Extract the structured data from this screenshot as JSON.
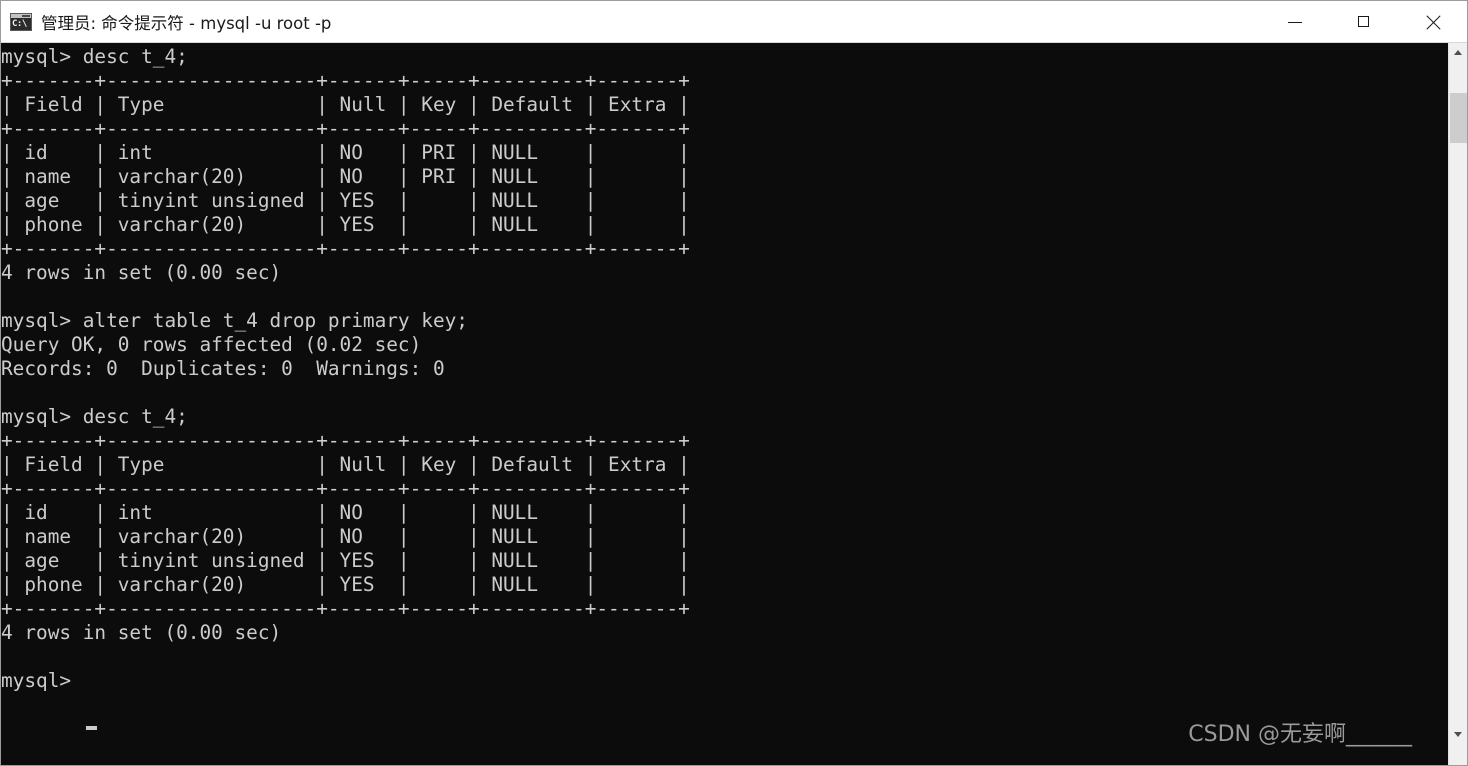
{
  "window": {
    "title": "管理员: 命令提示符 - mysql  -u root -p",
    "icon": "cmd-console-icon",
    "icon_text": "C:\\",
    "background": "#0c0c0c",
    "foreground": "#cccccc",
    "titlebar_background": "#ffffff"
  },
  "controls": {
    "minimize_label": "—",
    "maximize_label": "□",
    "close_label": "✕"
  },
  "terminal": {
    "prompt": "mysql>",
    "cursor": "_",
    "lines": [
      "mysql> desc t_4;",
      "+-------+------------------+------+-----+---------+-------+",
      "| Field | Type             | Null | Key | Default | Extra |",
      "+-------+------------------+------+-----+---------+-------+",
      "| id    | int              | NO   | PRI | NULL    |       |",
      "| name  | varchar(20)      | NO   | PRI | NULL    |       |",
      "| age   | tinyint unsigned | YES  |     | NULL    |       |",
      "| phone | varchar(20)      | YES  |     | NULL    |       |",
      "+-------+------------------+------+-----+---------+-------+",
      "4 rows in set (0.00 sec)",
      "",
      "mysql> alter table t_4 drop primary key;",
      "Query OK, 0 rows affected (0.02 sec)",
      "Records: 0  Duplicates: 0  Warnings: 0",
      "",
      "mysql> desc t_4;",
      "+-------+------------------+------+-----+---------+-------+",
      "| Field | Type             | Null | Key | Default | Extra |",
      "+-------+------------------+------+-----+---------+-------+",
      "| id    | int              | NO   |     | NULL    |       |",
      "| name  | varchar(20)      | NO   |     | NULL    |       |",
      "| age   | tinyint unsigned | YES  |     | NULL    |       |",
      "| phone | varchar(20)      | YES  |     | NULL    |       |",
      "+-------+------------------+------+-----+---------+-------+",
      "4 rows in set (0.00 sec)",
      "",
      "mysql> "
    ],
    "commands": [
      "desc t_4;",
      "alter table t_4 drop primary key;",
      "desc t_4;"
    ],
    "results": {
      "first_desc": {
        "columns": [
          "Field",
          "Type",
          "Null",
          "Key",
          "Default",
          "Extra"
        ],
        "rows": [
          [
            "id",
            "int",
            "NO",
            "PRI",
            "NULL",
            ""
          ],
          [
            "name",
            "varchar(20)",
            "NO",
            "PRI",
            "NULL",
            ""
          ],
          [
            "age",
            "tinyint unsigned",
            "YES",
            "",
            "NULL",
            ""
          ],
          [
            "phone",
            "varchar(20)",
            "YES",
            "",
            "NULL",
            ""
          ]
        ],
        "footer": "4 rows in set (0.00 sec)"
      },
      "alter_result": {
        "status": "Query OK, 0 rows affected (0.02 sec)",
        "detail": "Records: 0  Duplicates: 0  Warnings: 0"
      },
      "second_desc": {
        "columns": [
          "Field",
          "Type",
          "Null",
          "Key",
          "Default",
          "Extra"
        ],
        "rows": [
          [
            "id",
            "int",
            "NO",
            "",
            "NULL",
            ""
          ],
          [
            "name",
            "varchar(20)",
            "NO",
            "",
            "NULL",
            ""
          ],
          [
            "age",
            "tinyint unsigned",
            "YES",
            "",
            "NULL",
            ""
          ],
          [
            "phone",
            "varchar(20)",
            "YES",
            "",
            "NULL",
            ""
          ]
        ],
        "footer": "4 rows in set (0.00 sec)"
      }
    }
  },
  "watermark": {
    "text": "CSDN @无妄啊______"
  },
  "scrollbar": {
    "up_arrow": "chevron-up",
    "down_arrow": "chevron-down",
    "thumb_position_percent": 7
  }
}
